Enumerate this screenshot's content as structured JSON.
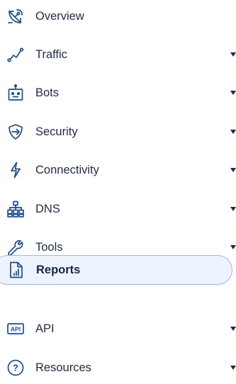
{
  "nav": {
    "items": [
      {
        "label": "Overview",
        "icon": "satellite-dish-icon",
        "has_dropdown": false,
        "active": false
      },
      {
        "label": "Traffic",
        "icon": "traffic-graph-icon",
        "has_dropdown": true,
        "active": false
      },
      {
        "label": "Bots",
        "icon": "robot-icon",
        "has_dropdown": true,
        "active": false
      },
      {
        "label": "Security",
        "icon": "shield-icon",
        "has_dropdown": true,
        "active": false
      },
      {
        "label": "Connectivity",
        "icon": "lightning-bolt-icon",
        "has_dropdown": true,
        "active": false
      },
      {
        "label": "DNS",
        "icon": "network-tree-icon",
        "has_dropdown": true,
        "active": false
      },
      {
        "label": "Tools",
        "icon": "wrench-icon",
        "has_dropdown": true,
        "active": false
      },
      {
        "label": "Reports",
        "icon": "report-document-icon",
        "has_dropdown": false,
        "active": true
      },
      {
        "label": "API",
        "icon": "api-icon",
        "has_dropdown": true,
        "active": false
      },
      {
        "label": "Resources",
        "icon": "help-circle-icon",
        "has_dropdown": true,
        "active": false
      }
    ]
  },
  "colors": {
    "icon": "#1f4b8f",
    "text": "#1f2a44",
    "active_background": "#eef4fd",
    "active_border": "#9db7e4"
  }
}
